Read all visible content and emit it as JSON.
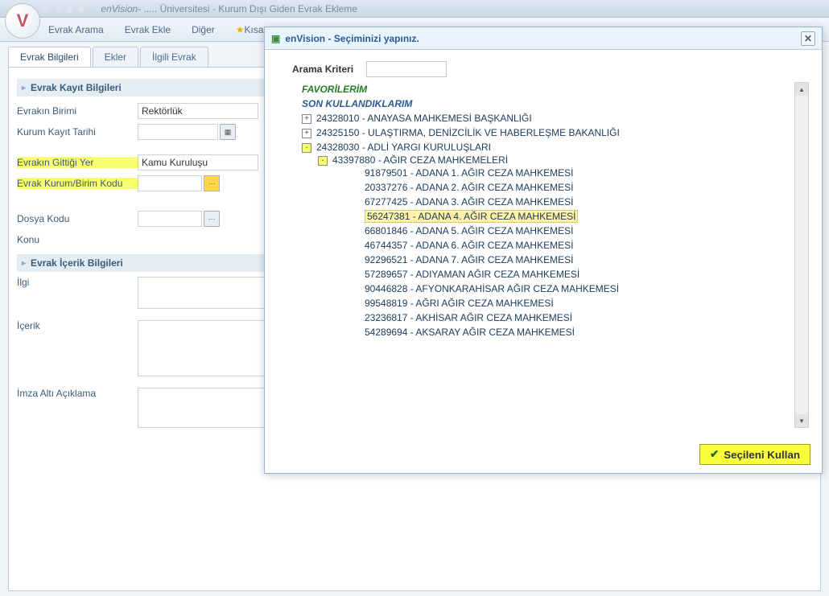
{
  "header": {
    "app": "enVision",
    "title_suffix": " - ..... Üniversitesi - Kurum Dışı Giden Evrak Ekleme"
  },
  "menu": {
    "evrak_arama": "Evrak Arama",
    "evrak_ekle": "Evrak Ekle",
    "diger": "Diğer",
    "kisayollar": "Kısay"
  },
  "tabs": {
    "evrak_bilgileri": "Evrak Bilgileri",
    "ekler": "Ekler",
    "ilgili_evrak": "İlgili Evrak"
  },
  "sections": {
    "kayit": "Evrak Kayıt Bilgileri",
    "icerik": "Evrak İçerik Bilgileri"
  },
  "form": {
    "evrakin_birimi_label": "Evrakın Birimi",
    "evrakin_birimi_value": "Rektörlük",
    "kurum_kayit_tarihi_label": "Kurum Kayıt Tarihi",
    "gittigi_yer_label": "Evrakın Gittiği Yer",
    "gittigi_yer_value": "Kamu Kuruluşu",
    "kurum_birim_kodu_label": "Evrak Kurum/Birim Kodu",
    "dosya_kodu_label": "Dosya Kodu",
    "konu_label": "Konu",
    "ilgi_label": "İlgi",
    "icerik_label": "İçerik",
    "imza_alti_label": "İmza Altı Açıklama"
  },
  "modal": {
    "title": "enVision - Seçiminizi yapınız.",
    "search_label": "Arama Kriteri",
    "favorites_label": "FAVORİLERİM",
    "recent_label": "SON KULLANDIKLARIM",
    "use_button": "Seçileni Kullan"
  },
  "tree": {
    "nodes": [
      {
        "id": "24328010",
        "label": "24328010 - ANAYASA MAHKEMESİ BAŞKANLIĞI",
        "expand": "+"
      },
      {
        "id": "24325150",
        "label": "24325150 - ULAŞTIRMA, DENİZCİLİK VE HABERLEŞME BAKANLIĞI",
        "expand": "+"
      },
      {
        "id": "24328030",
        "label": "24328030 - ADLİ YARGI KURULUŞLARI",
        "expand": "-",
        "hl": true
      }
    ],
    "child_node": {
      "id": "43397880",
      "label": "43397880 - AĞIR CEZA MAHKEMELERİ",
      "expand": "-",
      "hl": true
    },
    "leaves": [
      "91879501 - ADANA 1. AĞIR CEZA MAHKEMESİ",
      "20337276 - ADANA 2. AĞIR CEZA MAHKEMESİ",
      "67277425 - ADANA 3. AĞIR CEZA MAHKEMESİ",
      "56247381 - ADANA 4. AĞIR CEZA MAHKEMESİ",
      "66801846 - ADANA 5. AĞIR CEZA MAHKEMESİ",
      "46744357 - ADANA 6. AĞIR CEZA MAHKEMESİ",
      "92296521 - ADANA 7. AĞIR CEZA MAHKEMESİ",
      "57289657 - ADIYAMAN AĞIR CEZA MAHKEMESİ",
      "90446828 - AFYONKARAHİSAR AĞIR CEZA MAHKEMESİ",
      "99548819 - AĞRI AĞIR CEZA MAHKEMESİ",
      "23236817 - AKHİSAR AĞIR CEZA MAHKEMESİ",
      "54289694 - AKSARAY AĞIR CEZA MAHKEMESİ"
    ],
    "selected_index": 3
  }
}
